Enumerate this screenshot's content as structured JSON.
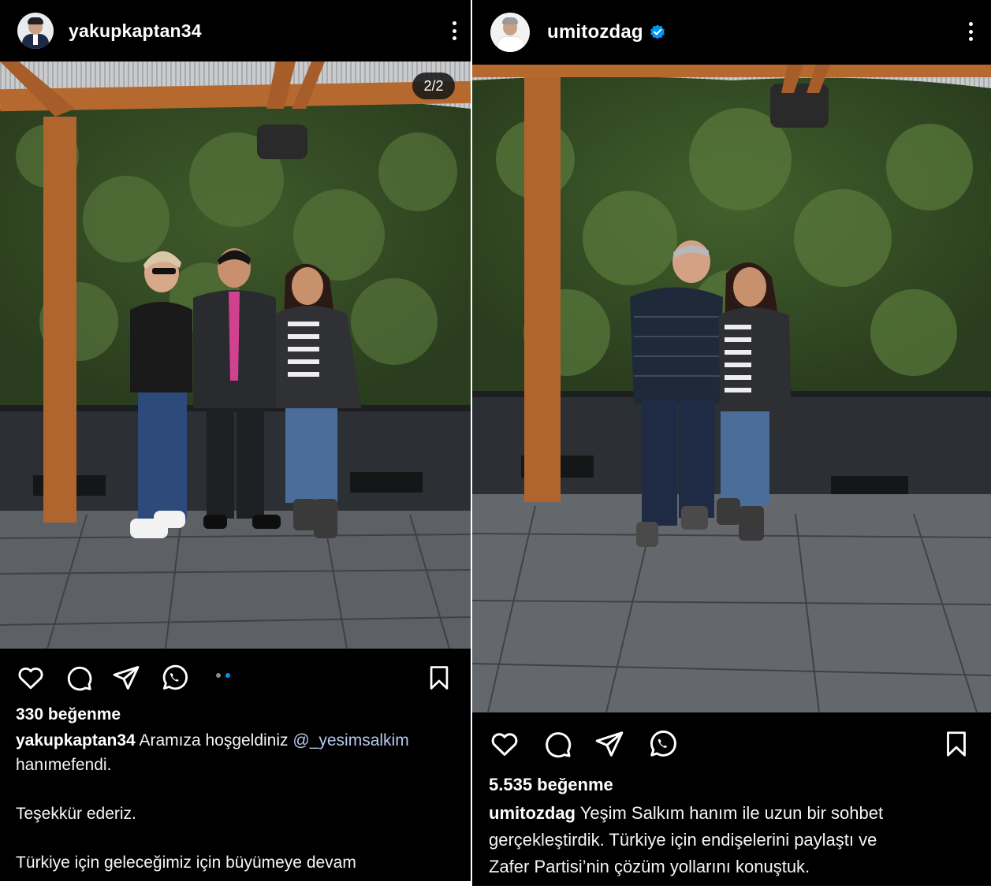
{
  "left_post": {
    "username": "yakupkaptan34",
    "carousel_counter": "2/2",
    "carousel_dots_total": 2,
    "carousel_dots_active": 2,
    "likes": "330 beğenme",
    "caption": {
      "author": "yakupkaptan34",
      "text_before": "Aramıza hoşgeldiniz",
      "mention": "@_yesimsalkim",
      "text_after": "hanımefendi.",
      "para2": "Teşekkür ederiz.",
      "para3": "Türkiye için geleceğimiz için büyümeye devam"
    },
    "icons": [
      "heart-icon",
      "comment-icon",
      "share-icon",
      "whatsapp-icon",
      "bookmark-icon",
      "more-options-icon"
    ]
  },
  "right_post": {
    "username": "umitozdag",
    "verified": true,
    "likes": "5.535 beğenme",
    "caption": {
      "author": "umitozdag",
      "line1": "Yeşim Salkım hanım ile uzun bir sohbet",
      "line2": "gerçekleştirdik. Türkiye için endişelerini paylaştı ve",
      "line3": "Zafer  Partisi’nin çözüm yollarını konuştuk."
    },
    "icons": [
      "heart-icon",
      "comment-icon",
      "share-icon",
      "whatsapp-icon",
      "bookmark-icon",
      "more-options-icon",
      "verified-badge-icon"
    ]
  },
  "colors": {
    "background": "#000000",
    "text": "#ffffff",
    "mention": "#b7c9ee",
    "verified_badge": "#0095f6",
    "active_dot": "#0095f6"
  }
}
